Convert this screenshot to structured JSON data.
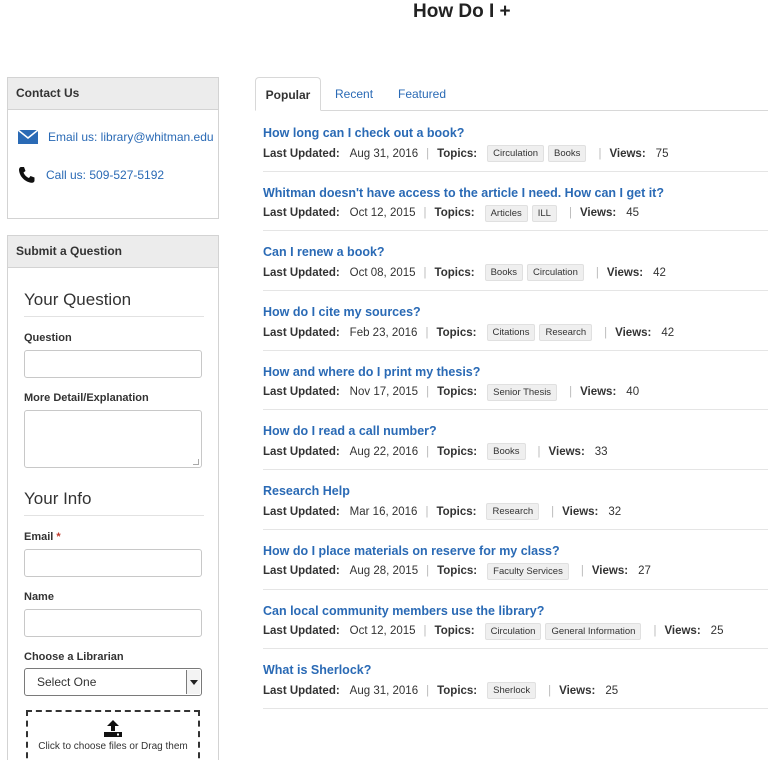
{
  "page_title": "How Do I +",
  "contact": {
    "heading": "Contact Us",
    "email_text": "Email us: library@whitman.edu",
    "phone_text": "Call us: 509-527-5192"
  },
  "submit": {
    "heading": "Submit a Question",
    "your_question_title": "Your Question",
    "question_label": "Question",
    "detail_label": "More Detail/Explanation",
    "your_info_title": "Your Info",
    "email_label": "Email",
    "required_mark": "*",
    "name_label": "Name",
    "librarian_label": "Choose a Librarian",
    "librarian_selected": "Select One",
    "upload_text": "Click to choose files or Drag them"
  },
  "tabs": [
    {
      "label": "Popular",
      "active": true
    },
    {
      "label": "Recent",
      "active": false
    },
    {
      "label": "Featured",
      "active": false
    }
  ],
  "meta_labels": {
    "updated": "Last Updated:",
    "topics": "Topics:",
    "views": "Views:"
  },
  "faqs": [
    {
      "question": "How long can I check out a book?",
      "updated": "Aug 31, 2016",
      "topics": [
        "Circulation",
        "Books"
      ],
      "views": "75"
    },
    {
      "question": "Whitman doesn't have access to the article I need. How can I get it?",
      "updated": "Oct 12, 2015",
      "topics": [
        "Articles",
        "ILL"
      ],
      "views": "45"
    },
    {
      "question": "Can I renew a book?",
      "updated": "Oct 08, 2015",
      "topics": [
        "Books",
        "Circulation"
      ],
      "views": "42"
    },
    {
      "question": "How do I cite my sources?",
      "updated": "Feb 23, 2016",
      "topics": [
        "Citations",
        "Research"
      ],
      "views": "42"
    },
    {
      "question": "How and where do I print my thesis?",
      "updated": "Nov 17, 2015",
      "topics": [
        "Senior Thesis"
      ],
      "views": "40"
    },
    {
      "question": "How do I read a call number?",
      "updated": "Aug 22, 2016",
      "topics": [
        "Books"
      ],
      "views": "33"
    },
    {
      "question": "Research Help",
      "updated": "Mar 16, 2016",
      "topics": [
        "Research"
      ],
      "views": "32"
    },
    {
      "question": "How do I place materials on reserve for my class?",
      "updated": "Aug 28, 2015",
      "topics": [
        "Faculty Services"
      ],
      "views": "27"
    },
    {
      "question": "Can local community members use the library?",
      "updated": "Oct 12, 2015",
      "topics": [
        "Circulation",
        "General Information"
      ],
      "views": "25"
    },
    {
      "question": "What is Sherlock?",
      "updated": "Aug 31, 2016",
      "topics": [
        "Sherlock"
      ],
      "views": "25"
    }
  ],
  "colors": {
    "link": "#2a6ab5",
    "panel_header": "#ececec",
    "required": "#c0392b"
  },
  "icons": {
    "email": "envelope-icon",
    "phone": "phone-icon",
    "upload": "upload-icon",
    "dropdown": "caret-down-icon"
  }
}
